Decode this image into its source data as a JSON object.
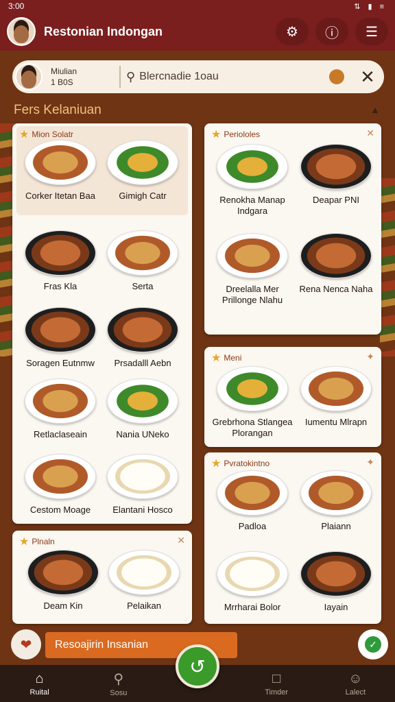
{
  "status": {
    "time": "3:00",
    "icons": "⇅ ▮ ≡"
  },
  "appbar": {
    "title": "Restonian Indongan"
  },
  "user": {
    "name": "Miulian",
    "points": "1 B0S"
  },
  "search": {
    "placeholder": "Blercnadie 1oau"
  },
  "section": {
    "title": "Fers Kelaniuan"
  },
  "left_card": {
    "heading": "Mion Solatr",
    "items": [
      "Corker Itetan Baa",
      "Gimigh Catr",
      "Fras Kla",
      "Serta",
      "Soragen Eutnmw",
      "Prsadalll Aebn",
      "Retlaclaseain",
      "Nania UNeko",
      "Cestom Moage",
      "Elantani Hosco"
    ]
  },
  "left_card2": {
    "heading": "Plnaln",
    "items": [
      "Deam Kin",
      "Pelaikan"
    ]
  },
  "right_card1": {
    "heading": "Periololes",
    "items": [
      "Renokha Manap Indgara",
      "Deapar PNI",
      "Dreelalla Mer Prillonge Nlahu",
      "Rena Nenca Naha"
    ]
  },
  "right_card2": {
    "heading": "Meni",
    "items": [
      "Grebrhona Stlangea Plorangan",
      "Iumentu Mlrapn"
    ]
  },
  "right_card3": {
    "heading": "Pvratokintno",
    "items": [
      "Padloa",
      "Plaiann",
      "Mrrharai Bolor",
      "Iayain"
    ]
  },
  "promo": {
    "label": "Resoajirin Insanian"
  },
  "nav": {
    "items": [
      "Ruital",
      "Sosu",
      "",
      "Timder",
      "Lalect"
    ]
  },
  "colors": {
    "primary": "#7a1e1e",
    "accent": "#d96a20",
    "fab": "#3a9a2a"
  }
}
